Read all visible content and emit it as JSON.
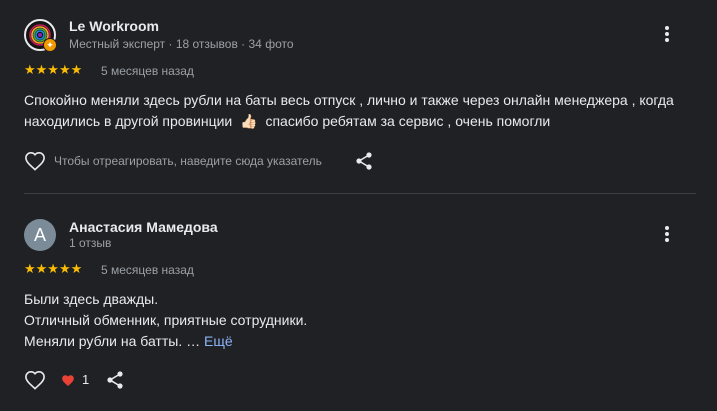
{
  "reviews": [
    {
      "author": "Le Workroom",
      "meta": "Местный эксперт · 18 отзывов · 34 фото",
      "rating": 5,
      "stars": "★★★★★",
      "date": "5 месяцев назад",
      "text_line1": "Спокойно меняли здесь рубли на баты весь отпуск , лично и также через онлайн менеджера , когда",
      "text_line2_a": "находились в другой провинции",
      "text_line2_emoji": "👍🏻",
      "text_line2_b": "спасибо ребятам за сервис , очень помогли",
      "hint": "Чтобы отреагировать, наведите сюда указатель"
    },
    {
      "author": "Анастасия Мамедова",
      "avatar_letter": "А",
      "meta": "1 отзыв",
      "rating": 5,
      "stars": "★★★★★",
      "date": "5 месяцев назад",
      "text_line1": "Были здесь дважды.",
      "text_line2": "Отличный обменник, приятные сотрудники.",
      "text_line3": "Меняли рубли на батты. …",
      "more_link": "Ещё",
      "likes": "1"
    }
  ],
  "colors": {
    "background": "#202124",
    "star": "#fbbc04",
    "link": "#8ab4f8",
    "heart": "#ea4335"
  },
  "icons": [
    "more-vert-icon",
    "heart-outline-icon",
    "share-icon",
    "heart-filled-icon",
    "local-guide-badge-icon"
  ]
}
